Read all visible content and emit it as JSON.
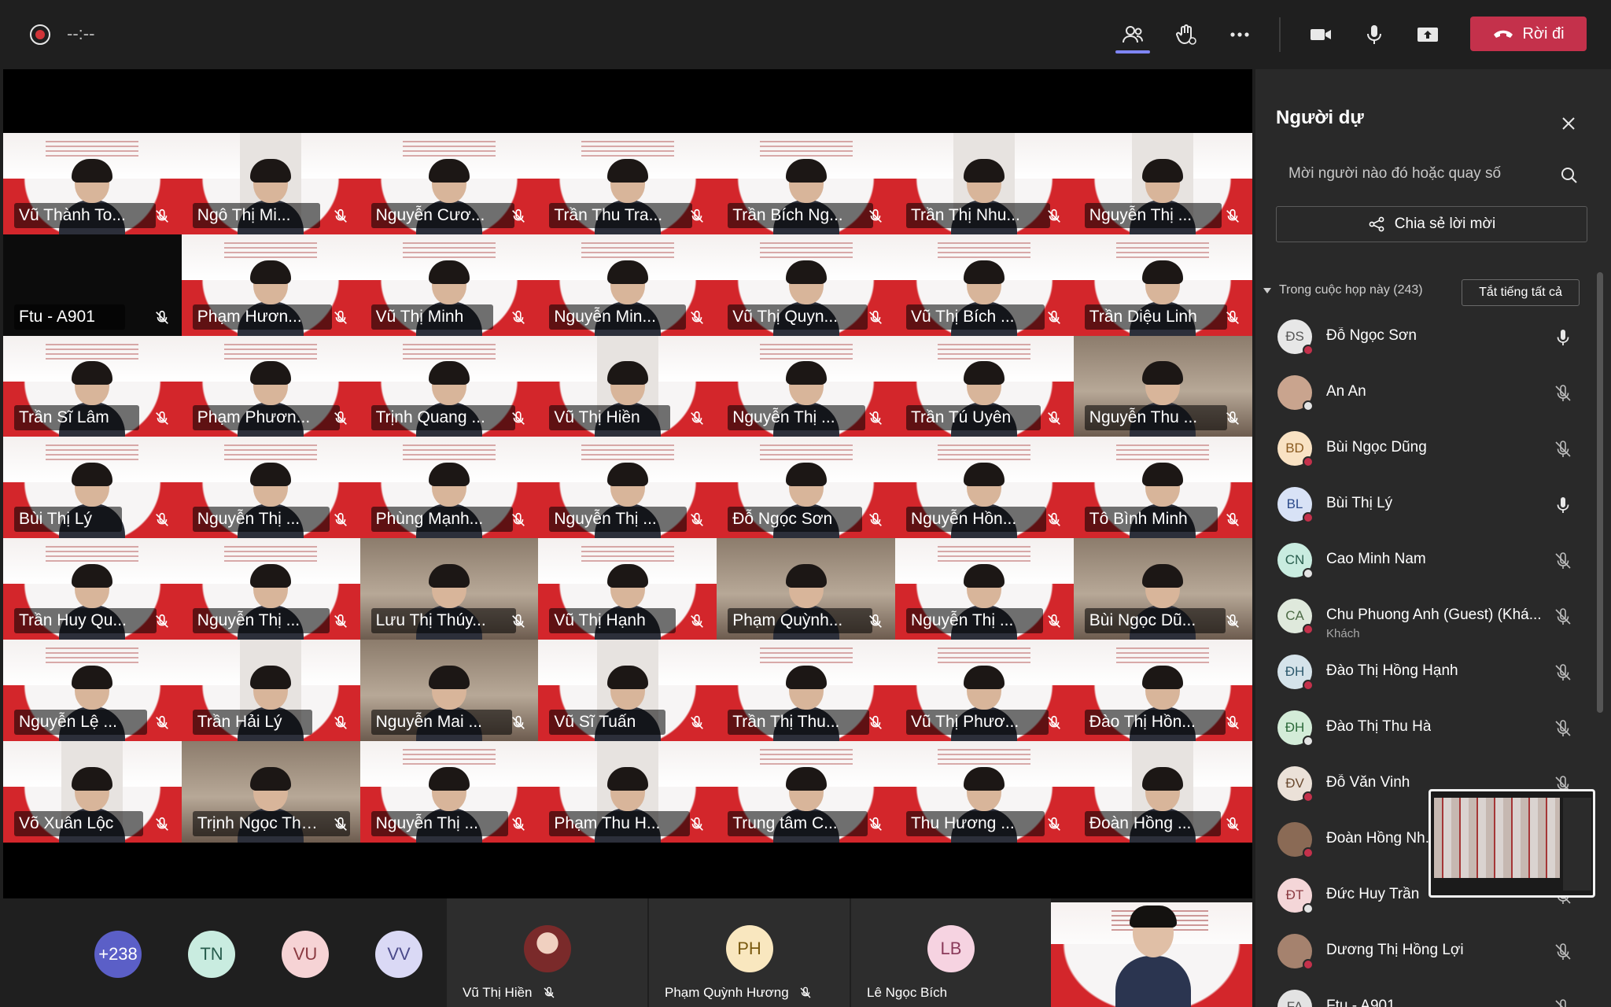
{
  "meeting": {
    "timer": "--:--",
    "leave_label": "Rời đi"
  },
  "grid": {
    "tiles": [
      {
        "name": "Vũ Thành To...",
        "style": "slide"
      },
      {
        "name": "Ngô Thị Mi...",
        "style": "cam"
      },
      {
        "name": "Nguyễn Cươ...",
        "style": "slide"
      },
      {
        "name": "Trần Thu Tra...",
        "style": "slide"
      },
      {
        "name": "Trần Bích Ng...",
        "style": "slide"
      },
      {
        "name": "Trần Thị Nhu...",
        "style": "cam"
      },
      {
        "name": "Nguyễn Thị ...",
        "style": "cam"
      },
      {
        "name": "Ftu - A901",
        "style": "dark"
      },
      {
        "name": "Phạm Hươn...",
        "style": "slide"
      },
      {
        "name": "Vũ Thị Minh",
        "style": "slide"
      },
      {
        "name": "Nguyễn Min...",
        "style": "slide"
      },
      {
        "name": "Vũ Thị Quyn...",
        "style": "slide"
      },
      {
        "name": "Vũ Thị Bích ...",
        "style": "slide"
      },
      {
        "name": "Trần Diệu Linh",
        "style": "slide"
      },
      {
        "name": "Trần Sĩ Lâm",
        "style": "slide"
      },
      {
        "name": "Phạm Phươn...",
        "style": "slide"
      },
      {
        "name": "Trịnh Quang ...",
        "style": "slide"
      },
      {
        "name": "Vũ Thị Hiền",
        "style": "cam"
      },
      {
        "name": "Nguyễn Thị ...",
        "style": "slide"
      },
      {
        "name": "Trần Tú Uyên",
        "style": "slide"
      },
      {
        "name": "Nguyễn Thu ...",
        "style": "photo"
      },
      {
        "name": "Bùi Thị Lý",
        "style": "slide"
      },
      {
        "name": "Nguyễn Thị ...",
        "style": "slide"
      },
      {
        "name": "Phùng Mạnh...",
        "style": "slide"
      },
      {
        "name": "Nguyễn Thị ...",
        "style": "slide"
      },
      {
        "name": "Đỗ Ngọc Sơn",
        "style": "slide"
      },
      {
        "name": "Nguyễn Hồn...",
        "style": "slide"
      },
      {
        "name": "Tô Bình Minh",
        "style": "slide"
      },
      {
        "name": "Trần Huy Qu...",
        "style": "slide"
      },
      {
        "name": "Nguyễn Thị ...",
        "style": "slide"
      },
      {
        "name": "Lưu Thị Thúy...",
        "style": "photo"
      },
      {
        "name": "Vũ Thị Hạnh",
        "style": "slide"
      },
      {
        "name": "Phạm Quỳnh...",
        "style": "photo"
      },
      {
        "name": "Nguyễn Thị ...",
        "style": "slide"
      },
      {
        "name": "Bùi Ngọc Dũ...",
        "style": "photo"
      },
      {
        "name": "Nguyễn Lệ ...",
        "style": "slide"
      },
      {
        "name": "Trần Hải Lý",
        "style": "cam"
      },
      {
        "name": "Nguyễn Mai ...",
        "style": "photo"
      },
      {
        "name": "Vũ Sĩ Tuấn",
        "style": "cam"
      },
      {
        "name": "Trần Thị Thu...",
        "style": "slide"
      },
      {
        "name": "Vũ Thị Phươ...",
        "style": "slide"
      },
      {
        "name": "Đào Thị Hồn...",
        "style": "slide"
      },
      {
        "name": "Võ Xuân Lộc",
        "style": "cam"
      },
      {
        "name": "Trịnh Ngọc Tha...",
        "style": "photo"
      },
      {
        "name": "Nguyễn Thị ...",
        "style": "slide"
      },
      {
        "name": "Phạm Thu H...",
        "style": "cam"
      },
      {
        "name": "Trung tâm C...",
        "style": "slide"
      },
      {
        "name": "Thu Hương ...",
        "style": "slide"
      },
      {
        "name": "Đoàn Hồng ...",
        "style": "cam"
      }
    ]
  },
  "strip": {
    "overflow_count": "+238",
    "bubbles": [
      "TN",
      "VU",
      "VV"
    ],
    "tiles": [
      {
        "name": "Vũ Thị Hiền",
        "initials": ""
      },
      {
        "name": "Phạm Quỳnh Hương",
        "initials": "PH"
      },
      {
        "name": "Lê Ngọc Bích",
        "initials": "LB"
      }
    ]
  },
  "panel": {
    "title": "Người dự",
    "search_placeholder": "Mời người nào đó hoặc quay số",
    "share_label": "Chia sẻ lời mời",
    "section_label": "Trong cuộc họp này (243)",
    "mute_all_label": "Tắt tiếng tất cả",
    "people": [
      {
        "initials": "ĐS",
        "name": "Đỗ Ngọc Sơn",
        "sub": "",
        "mic": "on",
        "bg": "#e7e7e7",
        "fg": "#555555"
      },
      {
        "initials": "",
        "name": "An An",
        "sub": "",
        "mic": "off",
        "bg": "#c9a48e",
        "fg": "#ffffff"
      },
      {
        "initials": "BD",
        "name": "Bùi Ngọc Dũng",
        "sub": "",
        "mic": "off",
        "bg": "#f9e2c3",
        "fg": "#8a5a20"
      },
      {
        "initials": "BL",
        "name": "Bùi Thị Lý",
        "sub": "",
        "mic": "on",
        "bg": "#d8e2f6",
        "fg": "#2c4a8a"
      },
      {
        "initials": "CN",
        "name": "Cao Minh Nam",
        "sub": "",
        "mic": "off",
        "bg": "#c9ece0",
        "fg": "#285d4d"
      },
      {
        "initials": "CA",
        "name": "Chu Phuong Anh (Guest) (Khá...",
        "sub": "Khách",
        "mic": "off",
        "bg": "#dfe9dc",
        "fg": "#4c6a45"
      },
      {
        "initials": "ĐH",
        "name": "Đào Thị Hồng Hạnh",
        "sub": "",
        "mic": "off",
        "bg": "#d5e3ea",
        "fg": "#2e5a6e"
      },
      {
        "initials": "ĐH",
        "name": "Đào Thị Thu Hà",
        "sub": "",
        "mic": "off",
        "bg": "#d3ecd8",
        "fg": "#2d6a3b"
      },
      {
        "initials": "ĐV",
        "name": "Đỗ Văn Vinh",
        "sub": "",
        "mic": "off",
        "bg": "#ebe1d8",
        "fg": "#6a4a30"
      },
      {
        "initials": "",
        "name": "Đoàn Hồng Nh...",
        "sub": "",
        "mic": "off",
        "bg": "#8a6a55",
        "fg": "#ffffff"
      },
      {
        "initials": "ĐT",
        "name": "Đức Huy Trần",
        "sub": "",
        "mic": "off",
        "bg": "#f4d6d8",
        "fg": "#8a3a41"
      },
      {
        "initials": "",
        "name": "Dương Thị Hồng Lợi",
        "sub": "",
        "mic": "off",
        "bg": "#a5826e",
        "fg": "#ffffff"
      },
      {
        "initials": "FA",
        "name": "Ftu - A901",
        "sub": "",
        "mic": "off",
        "bg": "#e3e3e3",
        "fg": "#555555"
      }
    ]
  },
  "colors": {
    "accent": "#7f85f5",
    "leave": "#c4314b",
    "slide_red": "#d3262b"
  }
}
